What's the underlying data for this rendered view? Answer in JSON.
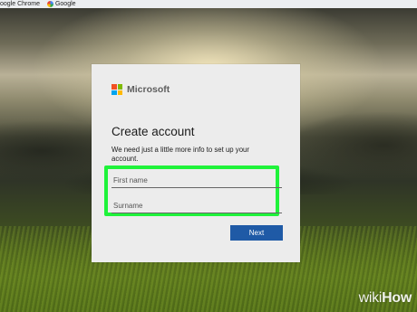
{
  "topbar": {
    "items": [
      {
        "label": "oogle Chrome",
        "icon": "chrome-icon"
      },
      {
        "label": "Google",
        "icon": "google-icon"
      }
    ]
  },
  "dialog": {
    "brand": "Microsoft",
    "brand_colors": [
      "#f25022",
      "#7fba00",
      "#00a4ef",
      "#ffb900"
    ],
    "title": "Create account",
    "subtitle": "We need just a little more info to set up your account.",
    "first_name": {
      "value": "",
      "placeholder": "First name"
    },
    "surname": {
      "value": "",
      "placeholder": "Surname"
    },
    "next_label": "Next",
    "next_color": "#1f5aa6",
    "highlight_color": "#1ff33a"
  },
  "watermark": {
    "part1": "wiki",
    "part2": "How"
  }
}
